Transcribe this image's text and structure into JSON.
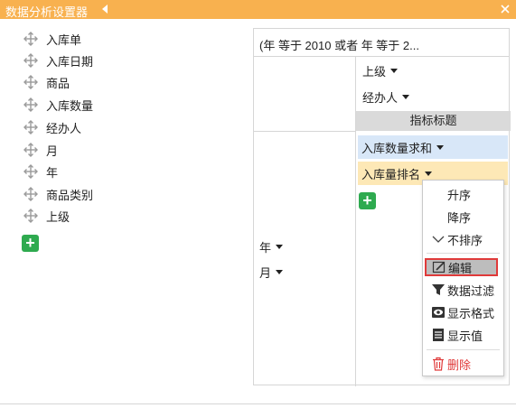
{
  "titlebar": {
    "title": "数据分析设置器",
    "accent": "#f8b14f"
  },
  "fields": [
    {
      "label": "入库单",
      "icon": "move-icon"
    },
    {
      "label": "入库日期",
      "icon": "move-icon"
    },
    {
      "label": "商品",
      "icon": "move-icon"
    },
    {
      "label": "入库数量",
      "icon": "move-icon"
    },
    {
      "label": "经办人",
      "icon": "move-icon"
    },
    {
      "label": "月",
      "icon": "move-icon"
    },
    {
      "label": "年",
      "icon": "move-icon"
    },
    {
      "label": "商品类别",
      "icon": "move-icon"
    },
    {
      "label": "上级",
      "icon": "move-icon"
    }
  ],
  "panel": {
    "filter": "(年 等于 2010 或者 年 等于 2...",
    "column_dims": [
      "上级",
      "经办人"
    ],
    "header": "指标标题",
    "measures": [
      "入库数量求和",
      "入库量排名"
    ],
    "row_dims": [
      "年",
      "月"
    ]
  },
  "menu": {
    "sort_items": [
      "升序",
      "降序",
      "不排序"
    ],
    "actions": [
      {
        "label": "编辑",
        "icon": "edit-icon"
      },
      {
        "label": "数据过滤",
        "icon": "filter-icon"
      },
      {
        "label": "显示格式",
        "icon": "eye-icon"
      },
      {
        "label": "显示值",
        "icon": "document-icon"
      }
    ],
    "delete": {
      "label": "删除",
      "icon": "trash-icon"
    }
  },
  "colors": {
    "add": "#2eaa4f",
    "measure_blue": "#d8e7f8",
    "measure_yellow": "#fde8b6",
    "danger": "#e03a3a"
  }
}
